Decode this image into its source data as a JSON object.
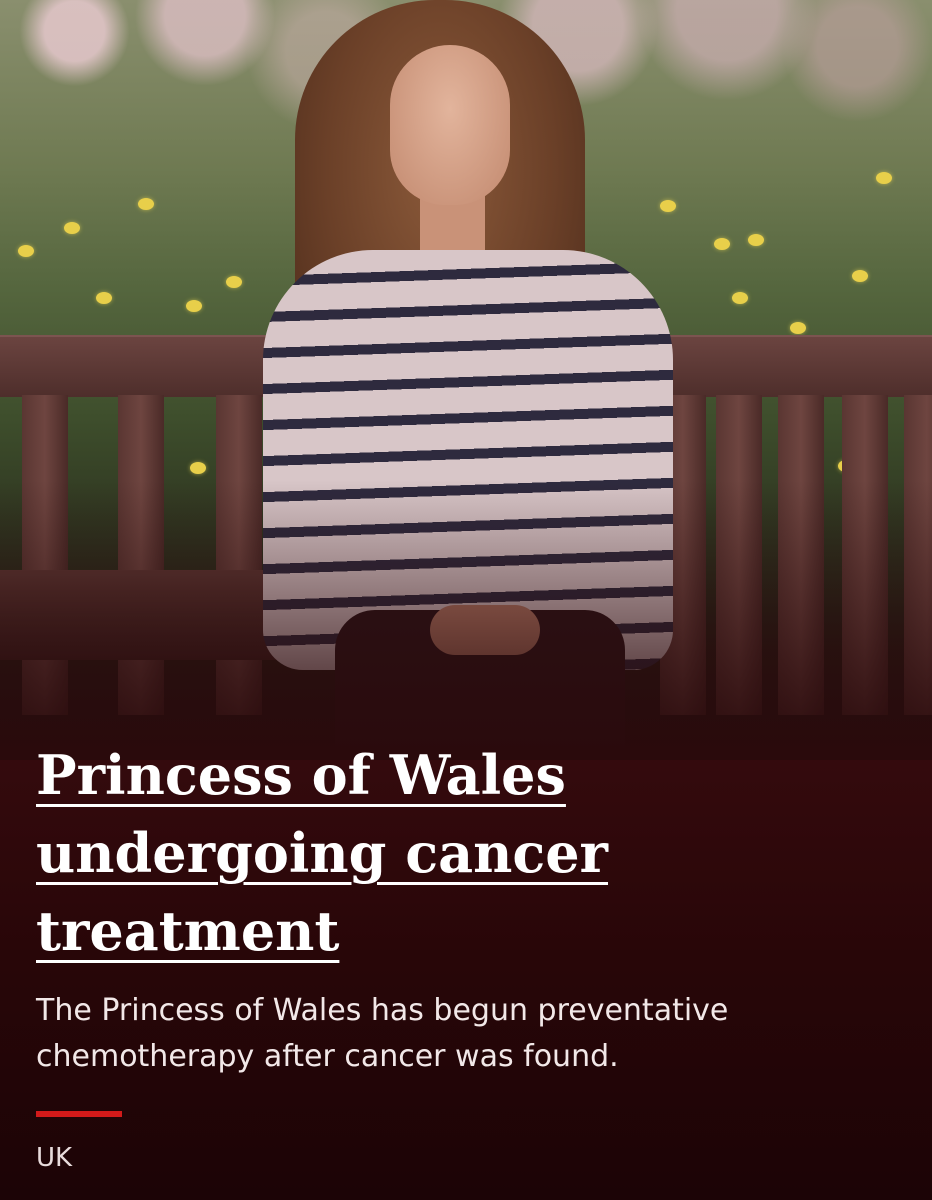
{
  "article": {
    "headline": "Princess of Wales undergoing cancer treatment",
    "summary": "The Princess of Wales has begun preventative chemotherapy after cancer was found.",
    "section": "UK"
  },
  "colors": {
    "background": "#2a0a0c",
    "headline_text": "#ffffff",
    "accent": "#d21a1a"
  }
}
